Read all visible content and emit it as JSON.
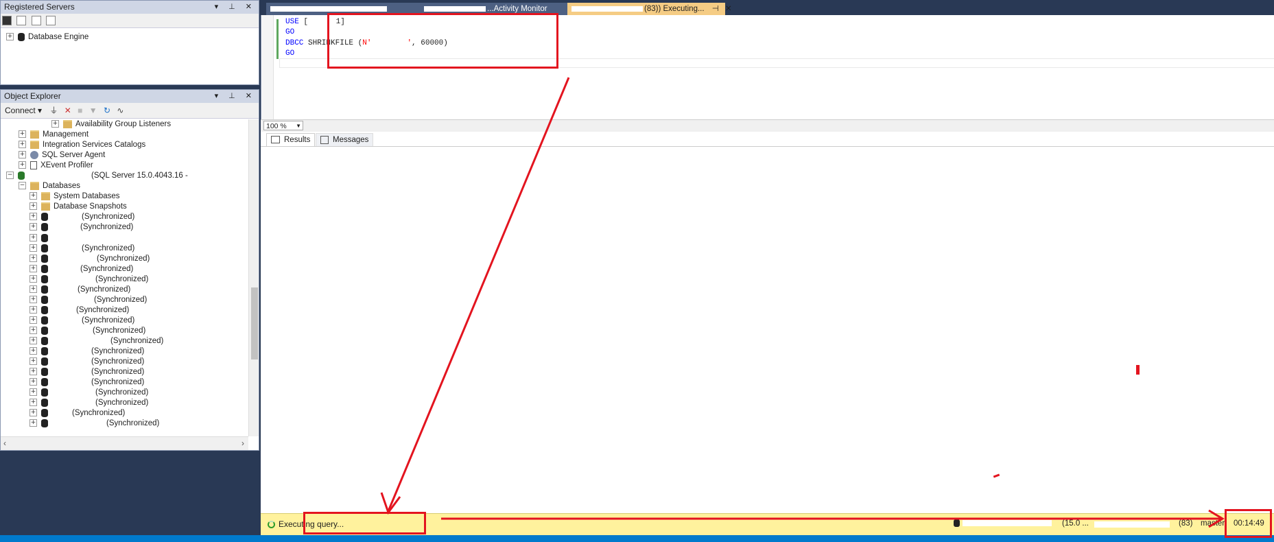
{
  "registered_servers": {
    "title": "Registered Servers",
    "tree": [
      {
        "label": "Database Engine"
      }
    ]
  },
  "object_explorer": {
    "title": "Object Explorer",
    "connect_label": "Connect",
    "items": [
      {
        "label": "Availability Group Listeners",
        "icon": "folder-icon"
      },
      {
        "label": "Management",
        "icon": "folder-icon"
      },
      {
        "label": "Integration Services Catalogs",
        "icon": "folder-icon"
      },
      {
        "label": "SQL Server Agent",
        "icon": "agent-icon"
      },
      {
        "label": "XEvent Profiler",
        "icon": "page-icon"
      },
      {
        "label": "(SQL Server 15.0.4043.16 -",
        "icon": "server-icon"
      },
      {
        "label": "Databases",
        "icon": "folder-icon"
      },
      {
        "label": "System Databases",
        "icon": "folder-icon"
      },
      {
        "label": "Database Snapshots",
        "icon": "folder-icon"
      },
      {
        "label": "(Synchronized)"
      },
      {
        "label": "(Synchronized)"
      },
      {
        "label": ""
      },
      {
        "label": "(Synchronized)"
      },
      {
        "label": "(Synchronized)"
      },
      {
        "label": "(Synchronized)"
      },
      {
        "label": "(Synchronized)"
      },
      {
        "label": "(Synchronized)"
      },
      {
        "label": "(Synchronized)"
      },
      {
        "label": "(Synchronized)"
      },
      {
        "label": "(Synchronized)"
      },
      {
        "label": "(Synchronized)"
      },
      {
        "label": "(Synchronized)"
      },
      {
        "label": "(Synchronized)"
      },
      {
        "label": "(Synchronized)"
      },
      {
        "label": "(Synchronized)"
      },
      {
        "label": "(Synchronized)"
      },
      {
        "label": "(Synchronized)"
      },
      {
        "label": "(Synchronized)"
      },
      {
        "label": "(Synchronized)"
      },
      {
        "label": "(Synchronized)"
      }
    ]
  },
  "tabs": [
    {
      "label": "...Activity Monitor"
    },
    {
      "label": "(83)) Executing..."
    }
  ],
  "editor": {
    "lines": [
      {
        "kw": "USE",
        "rest": " [",
        "tail": " 1]"
      },
      {
        "kw": "GO"
      },
      {
        "kw": "DBCC",
        "rest": " SHRINKFILE (",
        "str": "N'",
        "str2": "'",
        "tail": ", 60000)"
      },
      {
        "kw": "GO"
      }
    ],
    "zoom": "100 %"
  },
  "results_tabs": [
    {
      "label": "Results"
    },
    {
      "label": "Messages"
    }
  ],
  "status": {
    "executing": "Executing query...",
    "version": "(15.0 ...",
    "spid": "(83)",
    "db": "master",
    "elapsed": "00:14:49"
  },
  "colors": {
    "accent_red": "#e3141f",
    "status_yellow": "#fff29d",
    "tab_active": "#f5cc84"
  }
}
